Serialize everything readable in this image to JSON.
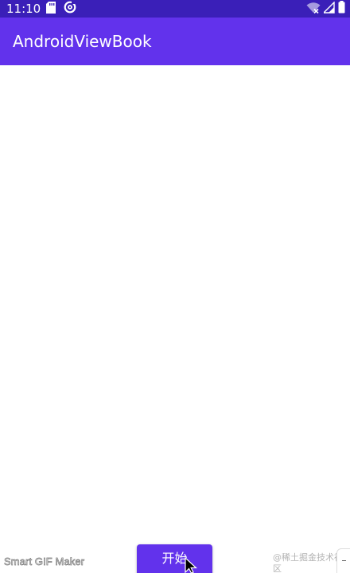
{
  "status_bar": {
    "time": "11:10",
    "color": "#3a1fb8",
    "icons_left": [
      "sd-card-icon",
      "data-saver-icon"
    ],
    "icons_right": [
      "wifi-icon",
      "cell-signal-icon",
      "battery-icon"
    ]
  },
  "app_bar": {
    "title": "AndroidViewBook",
    "color": "#6232ec"
  },
  "button": {
    "start_label": "开始",
    "color": "#6232ec"
  },
  "watermarks": {
    "left": "Smart GIF Maker",
    "right": "@稀土掘金技术社区"
  },
  "cursor": {
    "icon": "mouse-pointer-icon"
  }
}
